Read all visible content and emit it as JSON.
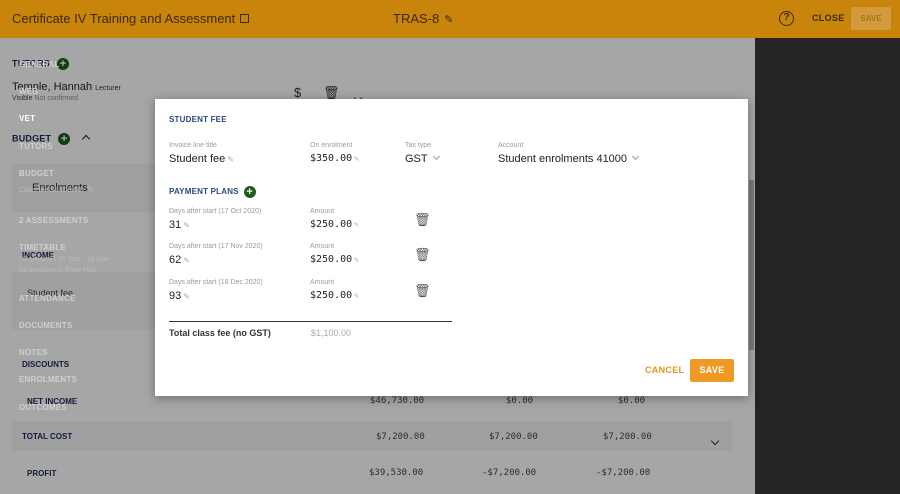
{
  "topbar": {
    "title": "Certificate IV Training and Assessment",
    "code": "TRAS-8",
    "close_label": "CLOSE",
    "save_label": "SAVE"
  },
  "main": {
    "tutors_heading": "TUTORS",
    "tutor": {
      "name": "Temple, Hannah",
      "role": "Lecturer",
      "visible": "Visible",
      "status": "Not confirmed"
    },
    "budget_heading": "BUDGET",
    "enrolments_label": "Enrolments",
    "income_label": "INCOME",
    "student_fee_label": "Student fee",
    "discounts_label": "DISCOUNTS",
    "net_income": {
      "label": "NET INCOME",
      "values": [
        "$46,730.00",
        "$0.00",
        "$0.00"
      ]
    },
    "total_cost": {
      "label": "TOTAL COST",
      "values": [
        "$7,200.00",
        "$7,200.00",
        "$7,200.00"
      ]
    },
    "profit": {
      "label": "PROFIT",
      "values": [
        "$39,530.00",
        "-$7,200.00",
        "-$7,200.00"
      ]
    }
  },
  "sidebar": {
    "items": [
      {
        "label": "GENERAL"
      },
      {
        "label": "WEB"
      },
      {
        "label": "VET"
      },
      {
        "label": "TUTORS"
      },
      {
        "label": "BUDGET",
        "sub": "Class fee $1,100.00"
      },
      {
        "label": "2 ASSESSMENTS"
      },
      {
        "label": "TIMETABLE",
        "sub": "10 sessions 16 Sep - 18 Nov",
        "sub2": "All sessions in Elder Hall"
      },
      {
        "label": "ATTENDANCE"
      },
      {
        "label": "DOCUMENTS"
      },
      {
        "label": "NOTES"
      },
      {
        "label": "ENROLMENTS"
      },
      {
        "label": "OUTCOMES"
      }
    ]
  },
  "modal": {
    "heading": "STUDENT FEE",
    "fields": {
      "invoice_line_label": "Invoice line title",
      "invoice_line_value": "Student fee",
      "on_enrolment_label": "On enrolment",
      "on_enrolment_value": "$350.00",
      "tax_type_label": "Tax type",
      "tax_type_value": "GST",
      "account_label": "Account",
      "account_value": "Student enrolments 41000"
    },
    "payment_plans_heading": "PAYMENT PLANS",
    "plans": [
      {
        "days_label": "Days after start (17 Oct 2020)",
        "days": "31",
        "amount_label": "Amount",
        "amount": "$250.00"
      },
      {
        "days_label": "Days after start (17 Nov 2020)",
        "days": "62",
        "amount_label": "Amount",
        "amount": "$250.00"
      },
      {
        "days_label": "Days after start (18 Dec 2020)",
        "days": "93",
        "amount_label": "Amount",
        "amount": "$250.00"
      }
    ],
    "total_label": "Total class fee (no GST)",
    "total_value": "$1,100.00",
    "cancel_label": "CANCEL",
    "save_label": "SAVE"
  }
}
